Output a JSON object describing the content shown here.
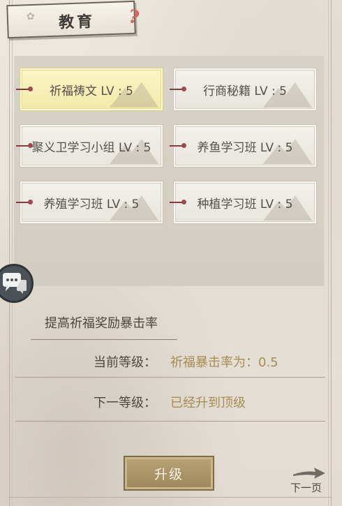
{
  "header": {
    "title": "教育",
    "help_glyph": "?"
  },
  "skills": [
    {
      "label": "祈福祷文 LV : 5",
      "selected": true
    },
    {
      "label": "行商秘籍 LV : 5",
      "selected": false
    },
    {
      "label": "聚义卫学习小组 LV : 5",
      "selected": false
    },
    {
      "label": "养鱼学习班 LV : 5",
      "selected": false
    },
    {
      "label": "养殖学习班 LV : 5",
      "selected": false
    },
    {
      "label": "种植学习班 LV : 5",
      "selected": false
    }
  ],
  "detail": {
    "description": "提高祈福奖励暴击率",
    "current_label": "当前等级：",
    "current_value": "祈福暴击率为：0.5",
    "next_label": "下一等级：",
    "next_value": "已经升到顶级"
  },
  "actions": {
    "upgrade_label": "升级",
    "next_page_label": "下一页"
  },
  "colors": {
    "accent_value": "#a88c55",
    "button": "#a8925f",
    "help": "#d9655a",
    "selected_card": "#f6ecb0"
  },
  "icons": {
    "chat": "chat-bubble-icon",
    "help": "question-mark-icon",
    "next": "arrow-right-icon"
  }
}
